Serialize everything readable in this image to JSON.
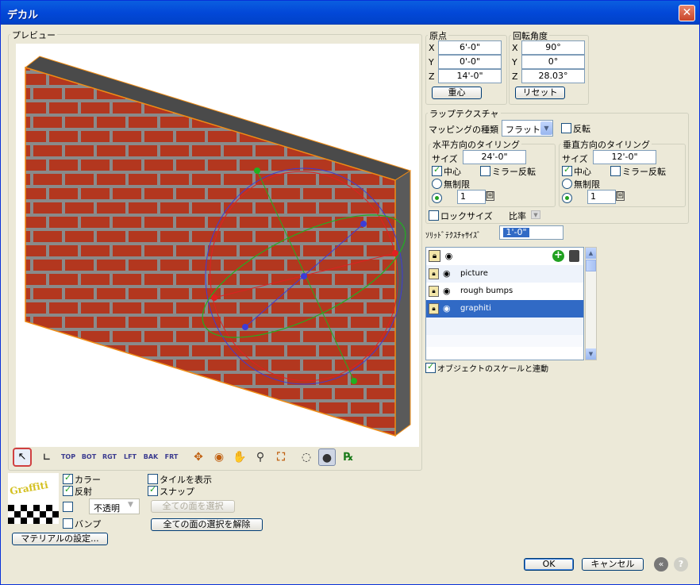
{
  "window": {
    "title": "デカル",
    "close": "✕"
  },
  "preview": {
    "label": "プレビュー"
  },
  "origin": {
    "label": "原点",
    "x_label": "X",
    "y_label": "Y",
    "z_label": "Z",
    "x": "6'-0\"",
    "y": "0'-0\"",
    "z": "14'-0\"",
    "center_button": "重心"
  },
  "rotation": {
    "label": "回転角度",
    "x_label": "X",
    "y_label": "Y",
    "z_label": "Z",
    "x": "90°",
    "y": "0°",
    "z": "28.03°",
    "reset_button": "リセット"
  },
  "wrap": {
    "label": "ラップテクスチャ",
    "mapping_label": "マッピングの種類",
    "mapping_value": "フラット",
    "flip_label": "反転"
  },
  "h_tiling": {
    "label": "水平方向のタイリング",
    "size_label": "サイズ",
    "size": "24'-0\"",
    "center_label": "中心",
    "mirror_label": "ミラー反転",
    "infinite_label": "無制限",
    "count": "1",
    "count_unit": "回"
  },
  "v_tiling": {
    "label": "垂直方向のタイリング",
    "size_label": "サイズ",
    "size": "12'-0\"",
    "center_label": "中心",
    "mirror_label": "ミラー反転",
    "infinite_label": "無制限",
    "count": "1",
    "count_unit": "回"
  },
  "lock_size_label": "ロックサイズ",
  "ratio_label": "比率",
  "solid_texture": {
    "label": "ｿﾘｯﾄﾞﾃｸｽﾁｬｻｲｽﾞ",
    "value": "1'-0\""
  },
  "layers": [
    {
      "name": "picture"
    },
    {
      "name": "rough  bumps"
    },
    {
      "name": "graphiti"
    }
  ],
  "link_scale_label": "オブジェクトのスケールと連動",
  "toolbar": {
    "top": "TOP",
    "bot": "BOT",
    "rgt": "RGT",
    "lft": "LFT",
    "bak": "BAK",
    "frt": "FRT"
  },
  "material": {
    "thumb_text": "Graffiti",
    "color_label": "カラー",
    "reflect_label": "反射",
    "opacity_value": "不透明",
    "bump_label": "バンプ",
    "settings_button": "マテリアルの設定...",
    "show_tiles_label": "タイルを表示",
    "snap_label": "スナップ",
    "select_all_button": "全ての面を選択",
    "deselect_all_button": "全ての面の選択を解除"
  },
  "footer": {
    "ok": "OK",
    "cancel": "キャンセル"
  },
  "colors": {
    "brick": "#b3371f",
    "mortar": "#8a8a8a",
    "title_blue": "#0348d8",
    "selection": "#316ac5"
  }
}
